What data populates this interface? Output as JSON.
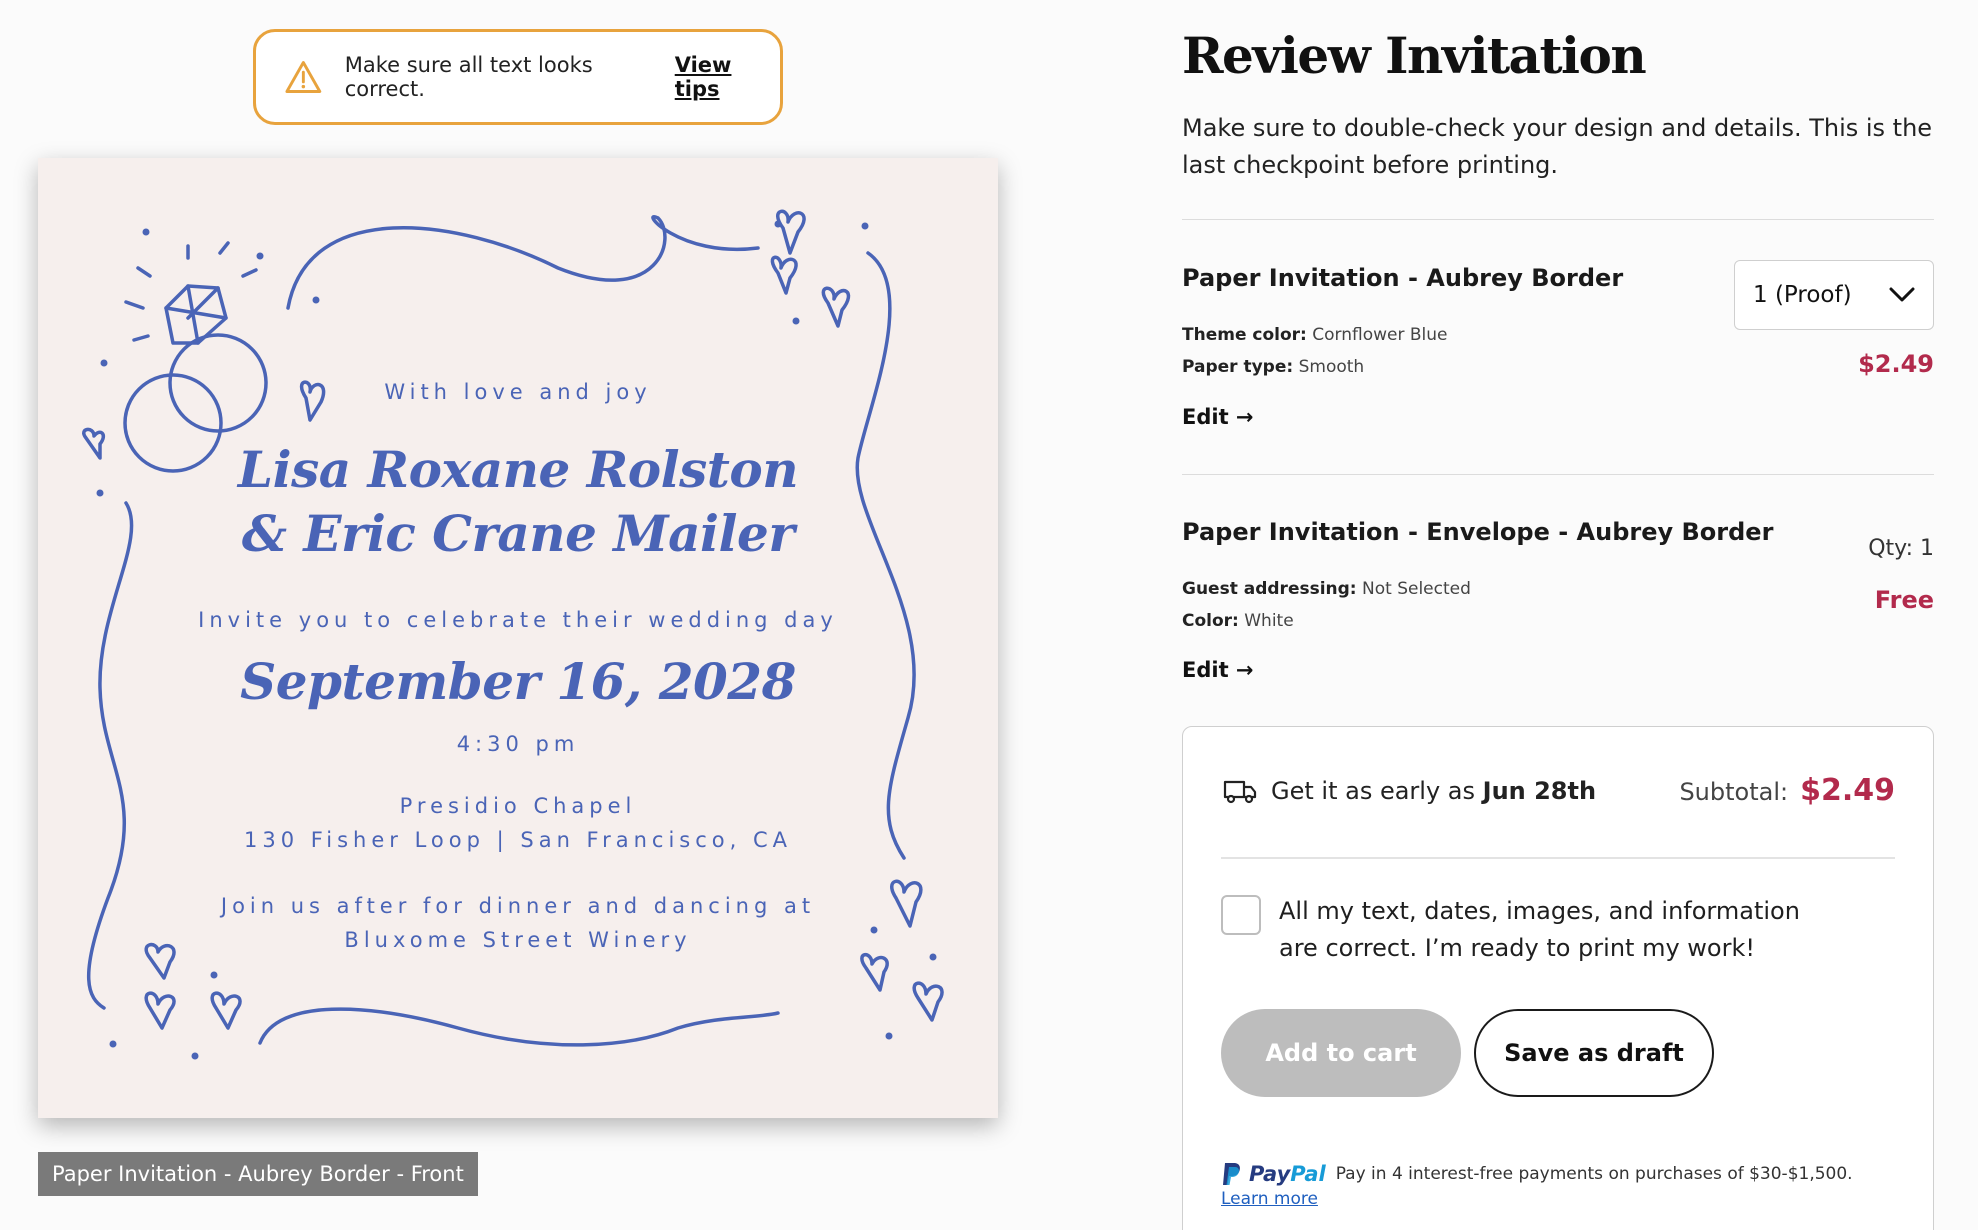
{
  "tip_banner": {
    "icon": "warning-icon",
    "text": "Make sure all text looks correct.",
    "link": "View tips"
  },
  "invitation": {
    "intro": "With love and joy",
    "names_line1": "Lisa Roxane Rolston",
    "names_line2": "& Eric Crane Mailer",
    "invite_line": "Invite you to celebrate their wedding day",
    "date": "September 16, 2028",
    "time": "4:30 pm",
    "venue": "Presidio Chapel",
    "address": "130 Fisher Loop | San Francisco, CA",
    "after_line1": "Join us after for dinner and dancing at",
    "after_line2": "Bluxome Street Winery",
    "ink_color": "#4a64b6",
    "paper_color": "#f6efed"
  },
  "preview_caption": "Paper Invitation - Aubrey Border - Front",
  "review": {
    "title": "Review Invitation",
    "subtitle": "Make sure to double-check your design and details. This is the last checkpoint before printing."
  },
  "items": [
    {
      "name": "Paper Invitation - Aubrey Border",
      "quantity_select": "1 (Proof)",
      "attr1_label": "Theme color:",
      "attr1_value": "Cornflower Blue",
      "attr2_label": "Paper type:",
      "attr2_value": "Smooth",
      "price": "$2.49",
      "edit_label": "Edit →"
    },
    {
      "name": "Paper Invitation - Envelope - Aubrey Border",
      "qty": "Qty: 1",
      "attr1_label": "Guest addressing:",
      "attr1_value": "Not Selected",
      "attr2_label": "Color:",
      "attr2_value": "White",
      "price": "Free",
      "edit_label": "Edit →"
    }
  ],
  "checkout": {
    "ship_prefix": "Get it as early as",
    "ship_date": "Jun 28th",
    "subtotal_label": "Subtotal:",
    "subtotal_amount": "$2.49",
    "confirm_text": "All my text, dates, images, and information are correct. I’m ready to print my work!",
    "add_to_cart": "Add to cart",
    "save_draft": "Save as draft",
    "paypal_brand_a": "Pay",
    "paypal_brand_b": "Pal",
    "paypal_text": "Pay in 4 interest-free payments on purchases of $30-$1,500.",
    "learn_more": "Learn more"
  },
  "colors": {
    "price_red": "#b22a4c",
    "warning_orange": "#e8a33d",
    "disabled_button": "#bdbdbd"
  }
}
